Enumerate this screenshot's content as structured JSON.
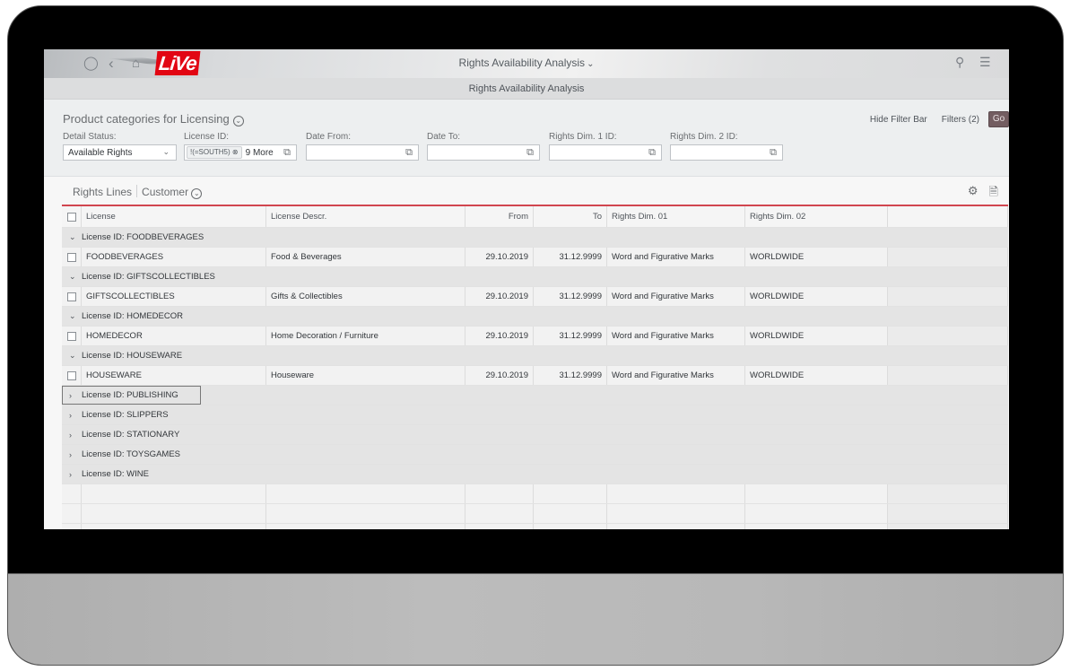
{
  "shell": {
    "title": "Rights Availability Analysis",
    "icons": {
      "user": "user-icon",
      "back": "back-icon",
      "home": "home-icon",
      "search": "search-icon",
      "menu": "menu-icon"
    },
    "logo_text": "LiVe",
    "logo_color": "#e20613"
  },
  "subheader": {
    "title": "Rights Availability Analysis"
  },
  "filterbar": {
    "variant_title": "Product categories for Licensing",
    "hide_filter_bar": "Hide Filter Bar",
    "filters": "Filters (2)",
    "go": "Go",
    "go_color": "#735d61",
    "fields": [
      {
        "label": "Detail Status:",
        "value": "Available Rights"
      },
      {
        "label": "License ID:",
        "token": "!(=SOUTH5)",
        "more": "9 More"
      },
      {
        "label": "Date From:",
        "value": ""
      },
      {
        "label": "Date To:",
        "value": ""
      },
      {
        "label": "Rights Dim. 1 ID:",
        "value": ""
      },
      {
        "label": "Rights Dim. 2 ID:",
        "value": ""
      }
    ]
  },
  "table": {
    "title": "Rights Lines",
    "variant": "Customer",
    "accent_color": "#d1464f",
    "columns": [
      "License",
      "License Descr.",
      "From",
      "To",
      "Rights Dim. 01",
      "Rights Dim. 02"
    ],
    "groups": [
      {
        "label": "License ID: FOODBEVERAGES",
        "expanded": true,
        "rows": [
          [
            "FOODBEVERAGES",
            "Food & Beverages",
            "29.10.2019",
            "31.12.9999",
            "Word and Figurative Marks",
            "WORLDWIDE"
          ]
        ]
      },
      {
        "label": "License ID: GIFTSCOLLECTIBLES",
        "expanded": true,
        "rows": [
          [
            "GIFTSCOLLECTIBLES",
            "Gifts & Collectibles",
            "29.10.2019",
            "31.12.9999",
            "Word and Figurative Marks",
            "WORLDWIDE"
          ]
        ]
      },
      {
        "label": "License ID: HOMEDECOR",
        "expanded": true,
        "rows": [
          [
            "HOMEDECOR",
            "Home Decoration / Furniture",
            "29.10.2019",
            "31.12.9999",
            "Word and Figurative Marks",
            "WORLDWIDE"
          ]
        ]
      },
      {
        "label": "License ID: HOUSEWARE",
        "expanded": true,
        "rows": [
          [
            "HOUSEWARE",
            "Houseware",
            "29.10.2019",
            "31.12.9999",
            "Word and Figurative Marks",
            "WORLDWIDE"
          ]
        ]
      },
      {
        "label": "License ID: PUBLISHING",
        "expanded": false,
        "focused": true,
        "rows": []
      },
      {
        "label": "License ID: SLIPPERS",
        "expanded": false,
        "rows": []
      },
      {
        "label": "License ID: STATIONARY",
        "expanded": false,
        "rows": []
      },
      {
        "label": "License ID: TOYSGAMES",
        "expanded": false,
        "rows": []
      },
      {
        "label": "License ID: WINE",
        "expanded": false,
        "rows": []
      }
    ],
    "empty_rows": 3
  }
}
